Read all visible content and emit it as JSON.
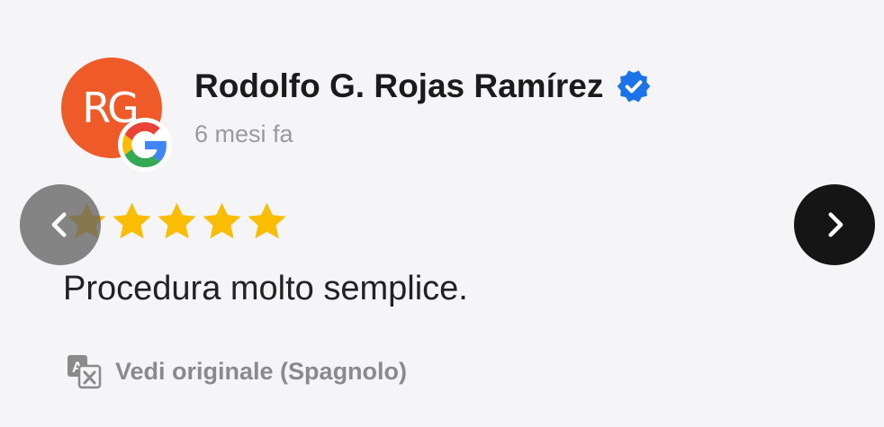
{
  "review": {
    "avatar_initials": "RG",
    "author_name": "Rodolfo G. Rojas Ramírez",
    "time_ago": "6 mesi fa",
    "rating": 5,
    "rating_max": 5,
    "text": "Procedura molto semplice.",
    "translate_label": "Vedi originale (Spagnolo)"
  },
  "icons": {
    "avatar_badge": "google-g-icon",
    "verified": "verified-badge-icon",
    "star": "star-icon",
    "translate": "translate-icon",
    "prev": "chevron-left-icon",
    "next": "chevron-right-icon"
  },
  "colors": {
    "avatar_bg": "#ef5a29",
    "star": "#fbbc04",
    "verified": "#1a73e8",
    "next_button_bg": "#151515",
    "prev_button_bg": "#646464"
  }
}
